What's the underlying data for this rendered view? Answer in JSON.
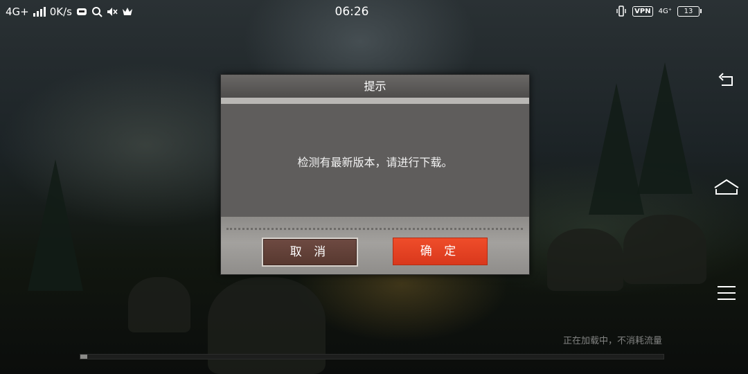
{
  "status_bar": {
    "network": "4G+",
    "speed": "0K/s",
    "time": "06:26",
    "vpn": "VPN",
    "network_right": "4G⁺",
    "battery": "13"
  },
  "dialog": {
    "title": "提示",
    "message": "检测有最新版本，请进行下载。",
    "cancel_label": "取 消",
    "confirm_label": "确 定"
  },
  "loading": {
    "text": "正在加载中，不消耗流量",
    "progress": 0.01
  },
  "nav": {
    "icons": [
      "back-icon",
      "home-icon",
      "menu-icon"
    ]
  },
  "colors": {
    "confirm": "#e8431f",
    "cancel": "#62413a",
    "dialog_bg": "#5f5d5c"
  }
}
